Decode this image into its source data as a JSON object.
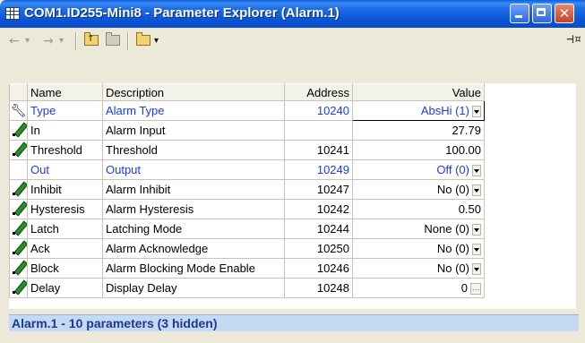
{
  "window": {
    "title": "COM1.ID255-Mini8 - Parameter Explorer (Alarm.1)"
  },
  "toolbar": {
    "back": "←",
    "back_menu": "▾",
    "forward": "→",
    "forward_menu": "▾",
    "icons": [
      "back-arrow-icon",
      "forward-arrow-icon",
      "parent-folder-icon",
      "folder-icon",
      "open-folder-icon",
      "pin-icon"
    ]
  },
  "grid": {
    "columns": [
      "Name",
      "Description",
      "Address",
      "Value"
    ],
    "rows": [
      {
        "icon": "wrench-icon",
        "name": "Type",
        "description": "Alarm Type",
        "address": "10240",
        "value": "AbsHi (1)",
        "control": "dropdown",
        "highlight": true
      },
      {
        "icon": "pencil-icon",
        "name": "In",
        "description": "Alarm Input",
        "address": "",
        "value": "27.79",
        "control": "none",
        "highlight": false
      },
      {
        "icon": "pencil-icon",
        "name": "Threshold",
        "description": "Threshold",
        "address": "10241",
        "value": "100.00",
        "control": "none",
        "highlight": false
      },
      {
        "icon": "",
        "name": "Out",
        "description": "Output",
        "address": "10249",
        "value": "Off (0)",
        "control": "dropdown",
        "highlight": true
      },
      {
        "icon": "pencil-icon",
        "name": "Inhibit",
        "description": "Alarm Inhibit",
        "address": "10247",
        "value": "No (0)",
        "control": "dropdown",
        "highlight": false
      },
      {
        "icon": "pencil-icon",
        "name": "Hysteresis",
        "description": "Alarm Hysteresis",
        "address": "10242",
        "value": "0.50",
        "control": "none",
        "highlight": false
      },
      {
        "icon": "pencil-icon",
        "name": "Latch",
        "description": "Latching Mode",
        "address": "10244",
        "value": "None (0)",
        "control": "dropdown",
        "highlight": false
      },
      {
        "icon": "pencil-icon",
        "name": "Ack",
        "description": "Alarm Acknowledge",
        "address": "10250",
        "value": "No (0)",
        "control": "dropdown",
        "highlight": false
      },
      {
        "icon": "pencil-icon",
        "name": "Block",
        "description": "Alarm Blocking Mode Enable",
        "address": "10246",
        "value": "No (0)",
        "control": "dropdown",
        "highlight": false
      },
      {
        "icon": "pencil-icon",
        "name": "Delay",
        "description": "Display Delay",
        "address": "10248",
        "value": "0",
        "control": "ellipsis",
        "highlight": false
      }
    ]
  },
  "status": {
    "text": "Alarm.1  -  10 parameters (3 hidden)"
  },
  "colors": {
    "title_bar": "#0a55d8",
    "highlight_text": "#1d3de0",
    "status_bg": "#c5d9f5",
    "status_text": "#1a3a8c",
    "window_bg": "#ece9d8"
  }
}
